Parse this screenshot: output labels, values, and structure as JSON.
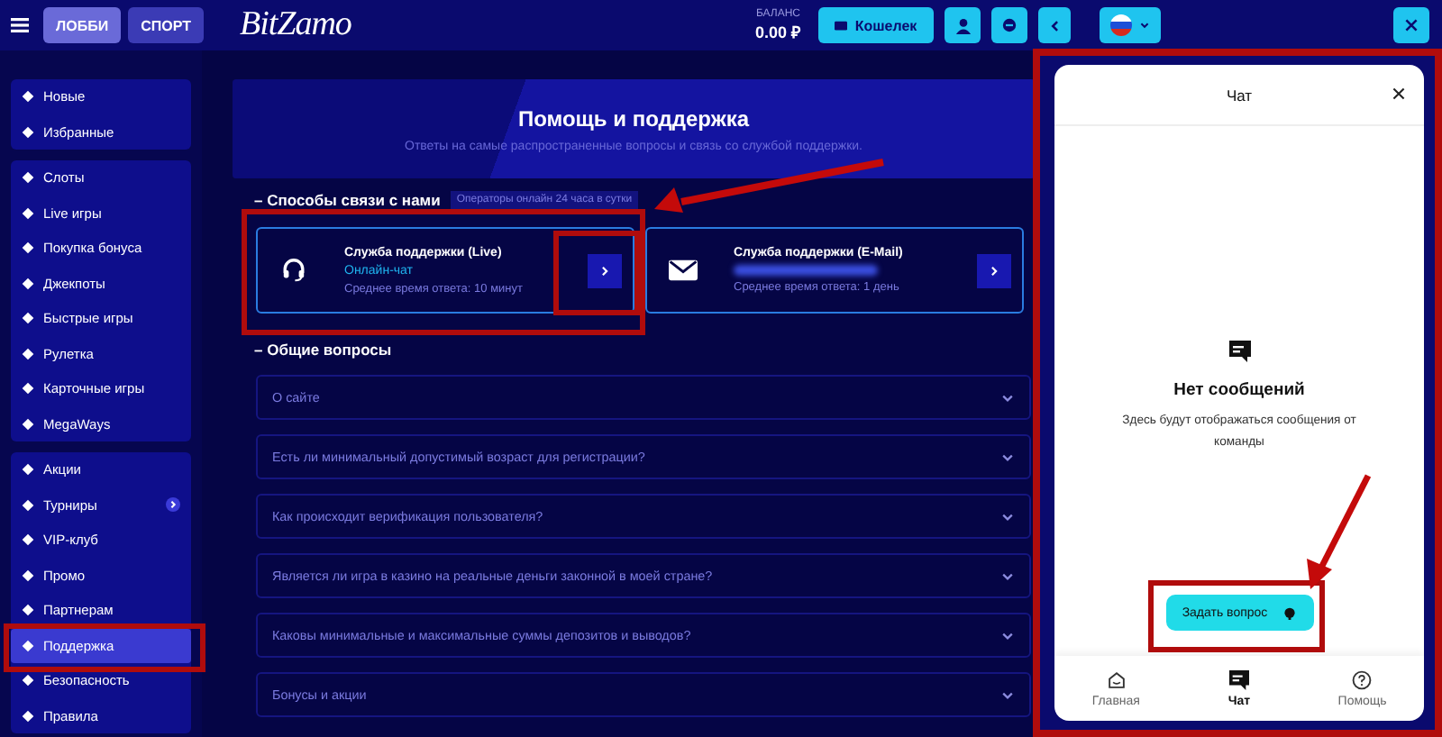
{
  "header": {
    "tabs": [
      {
        "label": "ЛОББИ",
        "selected": true
      },
      {
        "label": "СПОРТ",
        "selected": false
      }
    ],
    "logo": "BitZamo",
    "balance": {
      "label": "БАЛАНС",
      "value": "0.00 ₽"
    },
    "wallet_button": "Кошелек"
  },
  "sidebar": {
    "groups": [
      {
        "items": [
          {
            "label": "Новые",
            "selected": false,
            "has_arrow": false
          },
          {
            "label": "Избранные",
            "selected": false,
            "has_arrow": false
          }
        ]
      },
      {
        "items": [
          {
            "label": "Слоты",
            "selected": false,
            "has_arrow": false
          },
          {
            "label": "Live игры",
            "selected": false,
            "has_arrow": false
          },
          {
            "label": "Покупка бонуса",
            "selected": false,
            "has_arrow": false
          },
          {
            "label": "Джекпоты",
            "selected": false,
            "has_arrow": false
          },
          {
            "label": "Быстрые игры",
            "selected": false,
            "has_arrow": false
          },
          {
            "label": "Рулетка",
            "selected": false,
            "has_arrow": false
          },
          {
            "label": "Карточные игры",
            "selected": false,
            "has_arrow": false
          },
          {
            "label": "MegaWays",
            "selected": false,
            "has_arrow": false
          }
        ]
      },
      {
        "items": [
          {
            "label": "Акции",
            "selected": false,
            "has_arrow": false
          },
          {
            "label": "Турниры",
            "selected": false,
            "has_arrow": true
          },
          {
            "label": "VIP-клуб",
            "selected": false,
            "has_arrow": false
          },
          {
            "label": "Промо",
            "selected": false,
            "has_arrow": false
          },
          {
            "label": "Партнерам",
            "selected": false,
            "has_arrow": false
          },
          {
            "label": "Поддержка",
            "selected": true,
            "has_arrow": false
          },
          {
            "label": "Безопасность",
            "selected": false,
            "has_arrow": false
          },
          {
            "label": "Правила",
            "selected": false,
            "has_arrow": false
          }
        ]
      }
    ]
  },
  "support": {
    "title": "Помощь и поддержка",
    "subtitle": "Ответы на самые распространенные вопросы и связь со службой поддержки.",
    "contact_heading": "– Способы связи с нами",
    "online_badge": "Операторы онлайн 24 часа в сутки",
    "channels": [
      {
        "kind": "live",
        "title": "Служба поддержки (Live)",
        "subtitle": "Онлайн-чат",
        "response": "Среднее время ответа: 10 минут"
      },
      {
        "kind": "email",
        "title": "Служба поддержки (E-Mail)",
        "response": "Среднее время ответа: 1 день"
      }
    ],
    "faq_heading": "– Общие вопросы",
    "faq": [
      {
        "question": "О сайте",
        "expanded": false
      },
      {
        "question": "Есть ли минимальный допустимый возраст для регистрации?",
        "expanded": false
      },
      {
        "question": "Как происходит верификация пользователя?",
        "expanded": false
      },
      {
        "question": "Является ли игра в казино на реальные деньги законной в моей стране?",
        "expanded": false
      },
      {
        "question": "Каковы минимальные и максимальные суммы депозитов и выводов?",
        "expanded": false
      },
      {
        "question": "Бонусы и акции",
        "expanded": false
      }
    ]
  },
  "chat": {
    "title": "Чат",
    "empty_title": "Нет сообщений",
    "empty_text": "Здесь будут отображаться сообщения от команды",
    "ask_button": "Задать вопрос",
    "nav": [
      {
        "label": "Главная",
        "kind": "home",
        "selected": false
      },
      {
        "label": "Чат",
        "kind": "chat",
        "selected": true
      },
      {
        "label": "Помощь",
        "kind": "help",
        "selected": false
      }
    ]
  }
}
